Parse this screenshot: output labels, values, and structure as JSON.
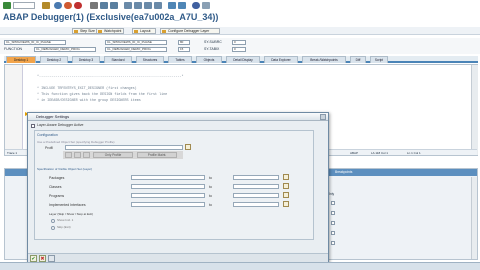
{
  "window": {
    "title": "ABAP Debugger(1)  (Exclusive(ea7u002a_A7U_34))"
  },
  "app_toolbar": {
    "buttons": [
      "Step Size",
      "Watchpoint",
      "Layout",
      "Configure Debugger Layer"
    ]
  },
  "info": {
    "row1": [
      "CL_SPRGVIEWS_ID_IC_PHASE",
      "CL_SPRGVIEWS_ID_IC_PHASE",
      "80",
      "SY-SUBRC",
      "0"
    ],
    "row2": [
      "FUNCTION",
      "CL_DEBUGGER_DEMO_PROG",
      "CL_DEBUGGER_DEMO_PROG",
      "15",
      "SY-TABIX",
      "0"
    ]
  },
  "tabs": [
    "Desktop 1",
    "Desktop 2",
    "Desktop 3",
    "Standard",
    "Structures",
    "Tables",
    "Objects",
    "Detail Display",
    "Data Explorer",
    "Break./Watchpoints",
    "Diff",
    "Script"
  ],
  "editor": {
    "lines": [
      "*----------------------------------------------------------------------*",
      "* INCLUDE TRFENTRYS_EXIT_DESIGNER  (first changes)",
      "* This function gives back the DESIGN fields from the first line",
      "* in IDEASB/DESIGNER with the group DESIGNERS items"
    ],
    "status_left": "Trace 1",
    "status_right": [
      "ABAP",
      "LA 118 Col 1",
      "Ln 1 Col 1"
    ]
  },
  "lower_panel": {
    "header_hint": "Breakpoints",
    "col_label": "Read Only"
  },
  "dialog": {
    "title": "Debugger Settings",
    "checkbox_label": "Layer-Aware Debugger Active",
    "section_title": "Configuration",
    "section_hint": "Use a Predefined Object Set (specifying Debugger Profile)",
    "profile_label": "Profil",
    "ops_buttons": [
      "Only Profile",
      "Profile Maint."
    ],
    "sub_section": "Specification of Visible Object Set (Layer)",
    "rows": [
      {
        "label": "Packages",
        "op": "to"
      },
      {
        "label": "Classes",
        "op": "to"
      },
      {
        "label": "Programs",
        "op": "to"
      },
      {
        "label": "Implemented Interfaces",
        "op": "to"
      }
    ],
    "layer_label": "Layer (Skip / Show / Stop at Exit)",
    "opt1": "Show Incl. 1",
    "opt2": "Skip (Exit)",
    "footer_ok": "✔",
    "footer_cancel": "✖"
  },
  "colors": {
    "accent": "#2f5a88",
    "tab_active": "#f2a44b",
    "tab_bar": "#4b84b7"
  }
}
